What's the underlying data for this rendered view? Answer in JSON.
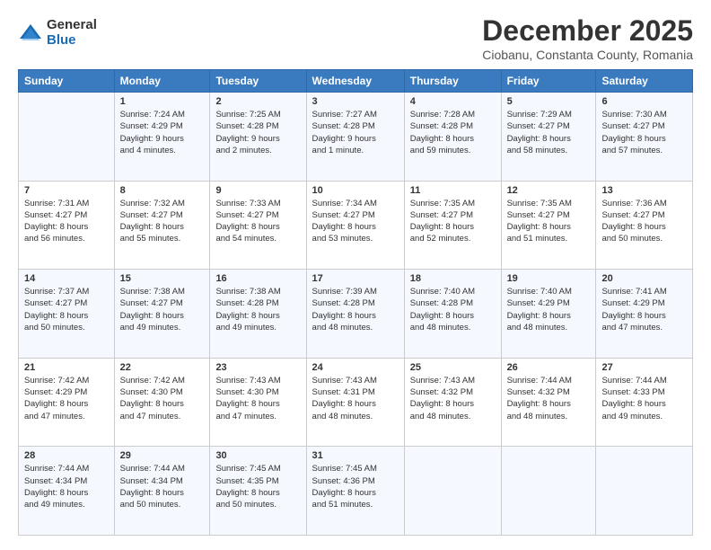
{
  "logo": {
    "general": "General",
    "blue": "Blue"
  },
  "title": "December 2025",
  "subtitle": "Ciobanu, Constanta County, Romania",
  "weekdays": [
    "Sunday",
    "Monday",
    "Tuesday",
    "Wednesday",
    "Thursday",
    "Friday",
    "Saturday"
  ],
  "weeks": [
    [
      {
        "day": "",
        "lines": []
      },
      {
        "day": "1",
        "lines": [
          "Sunrise: 7:24 AM",
          "Sunset: 4:29 PM",
          "Daylight: 9 hours",
          "and 4 minutes."
        ]
      },
      {
        "day": "2",
        "lines": [
          "Sunrise: 7:25 AM",
          "Sunset: 4:28 PM",
          "Daylight: 9 hours",
          "and 2 minutes."
        ]
      },
      {
        "day": "3",
        "lines": [
          "Sunrise: 7:27 AM",
          "Sunset: 4:28 PM",
          "Daylight: 9 hours",
          "and 1 minute."
        ]
      },
      {
        "day": "4",
        "lines": [
          "Sunrise: 7:28 AM",
          "Sunset: 4:28 PM",
          "Daylight: 8 hours",
          "and 59 minutes."
        ]
      },
      {
        "day": "5",
        "lines": [
          "Sunrise: 7:29 AM",
          "Sunset: 4:27 PM",
          "Daylight: 8 hours",
          "and 58 minutes."
        ]
      },
      {
        "day": "6",
        "lines": [
          "Sunrise: 7:30 AM",
          "Sunset: 4:27 PM",
          "Daylight: 8 hours",
          "and 57 minutes."
        ]
      }
    ],
    [
      {
        "day": "7",
        "lines": [
          "Sunrise: 7:31 AM",
          "Sunset: 4:27 PM",
          "Daylight: 8 hours",
          "and 56 minutes."
        ]
      },
      {
        "day": "8",
        "lines": [
          "Sunrise: 7:32 AM",
          "Sunset: 4:27 PM",
          "Daylight: 8 hours",
          "and 55 minutes."
        ]
      },
      {
        "day": "9",
        "lines": [
          "Sunrise: 7:33 AM",
          "Sunset: 4:27 PM",
          "Daylight: 8 hours",
          "and 54 minutes."
        ]
      },
      {
        "day": "10",
        "lines": [
          "Sunrise: 7:34 AM",
          "Sunset: 4:27 PM",
          "Daylight: 8 hours",
          "and 53 minutes."
        ]
      },
      {
        "day": "11",
        "lines": [
          "Sunrise: 7:35 AM",
          "Sunset: 4:27 PM",
          "Daylight: 8 hours",
          "and 52 minutes."
        ]
      },
      {
        "day": "12",
        "lines": [
          "Sunrise: 7:35 AM",
          "Sunset: 4:27 PM",
          "Daylight: 8 hours",
          "and 51 minutes."
        ]
      },
      {
        "day": "13",
        "lines": [
          "Sunrise: 7:36 AM",
          "Sunset: 4:27 PM",
          "Daylight: 8 hours",
          "and 50 minutes."
        ]
      }
    ],
    [
      {
        "day": "14",
        "lines": [
          "Sunrise: 7:37 AM",
          "Sunset: 4:27 PM",
          "Daylight: 8 hours",
          "and 50 minutes."
        ]
      },
      {
        "day": "15",
        "lines": [
          "Sunrise: 7:38 AM",
          "Sunset: 4:27 PM",
          "Daylight: 8 hours",
          "and 49 minutes."
        ]
      },
      {
        "day": "16",
        "lines": [
          "Sunrise: 7:38 AM",
          "Sunset: 4:28 PM",
          "Daylight: 8 hours",
          "and 49 minutes."
        ]
      },
      {
        "day": "17",
        "lines": [
          "Sunrise: 7:39 AM",
          "Sunset: 4:28 PM",
          "Daylight: 8 hours",
          "and 48 minutes."
        ]
      },
      {
        "day": "18",
        "lines": [
          "Sunrise: 7:40 AM",
          "Sunset: 4:28 PM",
          "Daylight: 8 hours",
          "and 48 minutes."
        ]
      },
      {
        "day": "19",
        "lines": [
          "Sunrise: 7:40 AM",
          "Sunset: 4:29 PM",
          "Daylight: 8 hours",
          "and 48 minutes."
        ]
      },
      {
        "day": "20",
        "lines": [
          "Sunrise: 7:41 AM",
          "Sunset: 4:29 PM",
          "Daylight: 8 hours",
          "and 47 minutes."
        ]
      }
    ],
    [
      {
        "day": "21",
        "lines": [
          "Sunrise: 7:42 AM",
          "Sunset: 4:29 PM",
          "Daylight: 8 hours",
          "and 47 minutes."
        ]
      },
      {
        "day": "22",
        "lines": [
          "Sunrise: 7:42 AM",
          "Sunset: 4:30 PM",
          "Daylight: 8 hours",
          "and 47 minutes."
        ]
      },
      {
        "day": "23",
        "lines": [
          "Sunrise: 7:43 AM",
          "Sunset: 4:30 PM",
          "Daylight: 8 hours",
          "and 47 minutes."
        ]
      },
      {
        "day": "24",
        "lines": [
          "Sunrise: 7:43 AM",
          "Sunset: 4:31 PM",
          "Daylight: 8 hours",
          "and 48 minutes."
        ]
      },
      {
        "day": "25",
        "lines": [
          "Sunrise: 7:43 AM",
          "Sunset: 4:32 PM",
          "Daylight: 8 hours",
          "and 48 minutes."
        ]
      },
      {
        "day": "26",
        "lines": [
          "Sunrise: 7:44 AM",
          "Sunset: 4:32 PM",
          "Daylight: 8 hours",
          "and 48 minutes."
        ]
      },
      {
        "day": "27",
        "lines": [
          "Sunrise: 7:44 AM",
          "Sunset: 4:33 PM",
          "Daylight: 8 hours",
          "and 49 minutes."
        ]
      }
    ],
    [
      {
        "day": "28",
        "lines": [
          "Sunrise: 7:44 AM",
          "Sunset: 4:34 PM",
          "Daylight: 8 hours",
          "and 49 minutes."
        ]
      },
      {
        "day": "29",
        "lines": [
          "Sunrise: 7:44 AM",
          "Sunset: 4:34 PM",
          "Daylight: 8 hours",
          "and 50 minutes."
        ]
      },
      {
        "day": "30",
        "lines": [
          "Sunrise: 7:45 AM",
          "Sunset: 4:35 PM",
          "Daylight: 8 hours",
          "and 50 minutes."
        ]
      },
      {
        "day": "31",
        "lines": [
          "Sunrise: 7:45 AM",
          "Sunset: 4:36 PM",
          "Daylight: 8 hours",
          "and 51 minutes."
        ]
      },
      {
        "day": "",
        "lines": []
      },
      {
        "day": "",
        "lines": []
      },
      {
        "day": "",
        "lines": []
      }
    ]
  ]
}
